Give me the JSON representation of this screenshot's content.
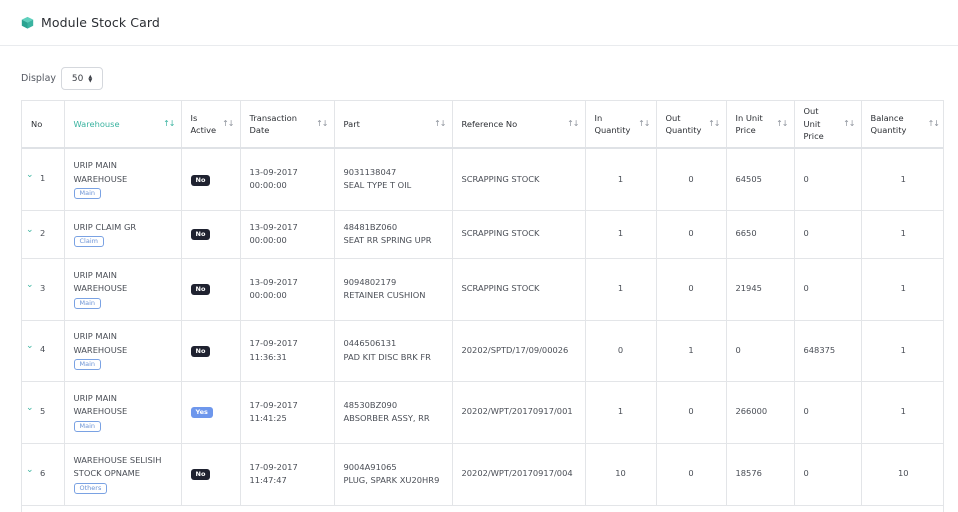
{
  "page": {
    "title": "Module Stock Card",
    "icon": "cube-icon",
    "accent_color": "#3ab3a0"
  },
  "display": {
    "label": "Display",
    "value": "50"
  },
  "table": {
    "columns": [
      "No",
      "Warehouse",
      "Is Active",
      "Transaction Date",
      "Part",
      "Reference No",
      "In Quantity",
      "Out Quantity",
      "In Unit Price",
      "Out Unit Price",
      "Balance Quantity"
    ],
    "rows": [
      {
        "no": "1",
        "warehouse": "URIP MAIN WAREHOUSE",
        "tag": "Main",
        "active": "No",
        "date": "13-09-2017",
        "time": "00:00:00",
        "part_no": "9031138047",
        "part_name": "SEAL TYPE T OIL",
        "ref": "SCRAPPING STOCK",
        "in_qty": "1",
        "out_qty": "0",
        "in_price": "64505",
        "out_price": "0",
        "balance": "1"
      },
      {
        "no": "2",
        "warehouse": "URIP CLAIM GR",
        "tag": "Claim",
        "active": "No",
        "date": "13-09-2017",
        "time": "00:00:00",
        "part_no": "48481BZ060",
        "part_name": "SEAT RR SPRING UPR",
        "ref": "SCRAPPING STOCK",
        "in_qty": "1",
        "out_qty": "0",
        "in_price": "6650",
        "out_price": "0",
        "balance": "1"
      },
      {
        "no": "3",
        "warehouse": "URIP MAIN WAREHOUSE",
        "tag": "Main",
        "active": "No",
        "date": "13-09-2017",
        "time": "00:00:00",
        "part_no": "9094802179",
        "part_name": "RETAINER CUSHION",
        "ref": "SCRAPPING STOCK",
        "in_qty": "1",
        "out_qty": "0",
        "in_price": "21945",
        "out_price": "0",
        "balance": "1"
      },
      {
        "no": "4",
        "warehouse": "URIP MAIN WAREHOUSE",
        "tag": "Main",
        "active": "No",
        "date": "17-09-2017",
        "time": "11:36:31",
        "part_no": "0446506131",
        "part_name": "PAD KIT DISC BRK FR",
        "ref": "20202/SPTD/17/09/00026",
        "in_qty": "0",
        "out_qty": "1",
        "in_price": "0",
        "out_price": "648375",
        "balance": "1"
      },
      {
        "no": "5",
        "warehouse": "URIP MAIN WAREHOUSE",
        "tag": "Main",
        "active": "Yes",
        "date": "17-09-2017",
        "time": "11:41:25",
        "part_no": "48530BZ090",
        "part_name": "ABSORBER ASSY, RR",
        "ref": "20202/WPT/20170917/001",
        "in_qty": "1",
        "out_qty": "0",
        "in_price": "266000",
        "out_price": "0",
        "balance": "1"
      },
      {
        "no": "6",
        "warehouse": "WAREHOUSE SELISIH STOCK OPNAME",
        "tag": "Others",
        "active": "No",
        "date": "17-09-2017",
        "time": "11:47:47",
        "part_no": "9004A91065",
        "part_name": "PLUG, SPARK XU20HR9",
        "ref": "20202/WPT/20170917/004",
        "in_qty": "10",
        "out_qty": "0",
        "in_price": "18576",
        "out_price": "0",
        "balance": "10"
      }
    ]
  }
}
